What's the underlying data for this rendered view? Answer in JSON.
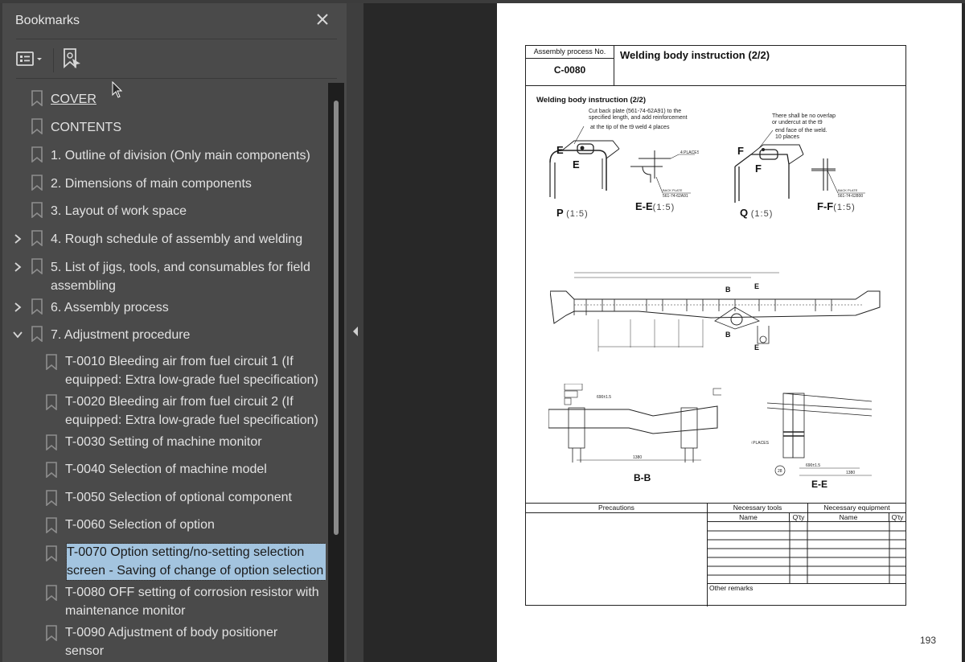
{
  "sidebar": {
    "title": "Bookmarks",
    "close_icon": "close-icon",
    "toolbar": {
      "options_icon": "list-options-icon",
      "find_bookmark_icon": "find-current-bookmark-icon"
    },
    "items": [
      {
        "label": "COVER",
        "level": 0,
        "expandable": false,
        "underlined": true
      },
      {
        "label": "CONTENTS",
        "level": 0,
        "expandable": false
      },
      {
        "label": "1. Outline of division (Only main components)",
        "level": 0,
        "expandable": false
      },
      {
        "label": "2. Dimensions of main components",
        "level": 0,
        "expandable": false
      },
      {
        "label": "3. Layout of work space",
        "level": 0,
        "expandable": false
      },
      {
        "label": "4. Rough schedule of assembly and welding",
        "level": 0,
        "expandable": true,
        "expanded": false
      },
      {
        "label": "5. List of jigs, tools, and consumables for field assembling",
        "level": 0,
        "expandable": true,
        "expanded": false
      },
      {
        "label": "6. Assembly process",
        "level": 0,
        "expandable": true,
        "expanded": false
      },
      {
        "label": "7. Adjustment procedure",
        "level": 0,
        "expandable": true,
        "expanded": true
      },
      {
        "label": "T-0010  Bleeding air from fuel circuit 1 (If equipped: Extra low-grade fuel specification)",
        "level": 1
      },
      {
        "label": "T-0020  Bleeding air from fuel circuit 2 (If equipped: Extra low-grade fuel specification)",
        "level": 1
      },
      {
        "label": "T-0030  Setting of machine monitor",
        "level": 1
      },
      {
        "label": "T-0040  Selection of machine model",
        "level": 1
      },
      {
        "label": "T-0050  Selection of optional component",
        "level": 1
      },
      {
        "label": "T-0060  Selection of option",
        "level": 1
      },
      {
        "label": "T-0070  Option setting/no-setting selection screen - Saving of change of option selection",
        "level": 1,
        "selected": true
      },
      {
        "label": "T-0080  OFF setting of corrosion resistor with maintenance monitor",
        "level": 1
      },
      {
        "label": "T-0090  Adjustment of body positioner sensor",
        "level": 1
      }
    ],
    "selection_color": "#a3c4df"
  },
  "document": {
    "header": {
      "process_label": "Assembly process No.",
      "process_number": "C-0080",
      "title": "Welding body instruction (2/2)"
    },
    "section_title": "Welding body instruction (2/2)",
    "notes": {
      "p_note_1": "Cut back plate (561-74-62A91) to the",
      "p_note_2": "specified length, and add reinforcement",
      "p_note_3": "at the tip of the t9 weld 4 places",
      "q_note_1": "There shall be no overlap",
      "q_note_2": "or undercut at the t9",
      "q_note_3": "end face of the weld.",
      "q_note_4": "10 places"
    },
    "views": {
      "p": "P",
      "p_scale": "(1:5)",
      "ee_small": "E-E",
      "ee_small_scale": "(1:5)",
      "q": "Q",
      "q_scale": "(1:5)",
      "ff": "F-F",
      "ff_scale": "(1:5)",
      "bb": "B-B",
      "ee": "E-E",
      "back_plate_1": "561-74-62A91",
      "back_plate_2": "561-74-62800",
      "dim_1380": "1380",
      "dim_690": "690±1.5"
    },
    "table": {
      "precautions": "Precautions",
      "tools": "Necessary tools",
      "equipment": "Necessary equipment",
      "name": "Name",
      "qty": "Q'ty",
      "other_remarks": "Other remarks"
    },
    "page_number": "193"
  }
}
